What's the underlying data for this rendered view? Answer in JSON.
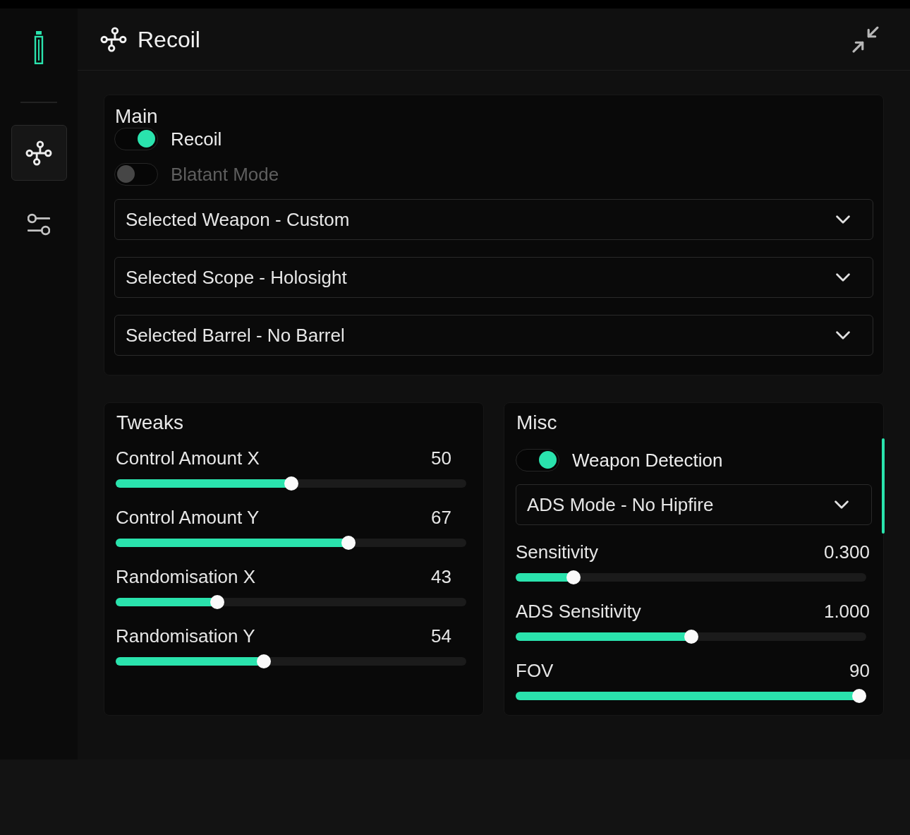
{
  "sidebar": {
    "items": [
      {
        "kind": "route",
        "selected": true
      },
      {
        "kind": "sliders",
        "selected": false
      }
    ]
  },
  "header": {
    "title": "Recoil"
  },
  "main": {
    "title": "Main",
    "toggles": [
      {
        "label": "Recoil",
        "on": true
      },
      {
        "label": "Blatant Mode",
        "on": false
      }
    ],
    "dropdowns": [
      {
        "value": "Selected Weapon - Custom"
      },
      {
        "value": "Selected Scope - Holosight"
      },
      {
        "value": "Selected Barrel - No Barrel"
      }
    ]
  },
  "tweaks": {
    "title": "Tweaks",
    "sliders": [
      {
        "label": "Control Amount X",
        "reading": "50",
        "level": 0.5
      },
      {
        "label": "Control Amount Y",
        "reading": "67",
        "level": 0.67
      },
      {
        "label": "Randomisation X",
        "reading": "43",
        "level": 0.28
      },
      {
        "label": "Randomisation Y",
        "reading": "54",
        "level": 0.42
      }
    ]
  },
  "misc": {
    "title": "Misc",
    "toggles": [
      {
        "label": "Weapon Detection",
        "on": true
      }
    ],
    "dropdowns": [
      {
        "value": "ADS Mode - No Hipfire"
      }
    ],
    "sliders": [
      {
        "label": "Sensitivity",
        "reading": "0.300",
        "level": 0.15
      },
      {
        "label": "ADS Sensitivity",
        "reading": "1.000",
        "level": 0.5
      },
      {
        "label": "FOV",
        "reading": "90",
        "level": 1
      }
    ]
  }
}
